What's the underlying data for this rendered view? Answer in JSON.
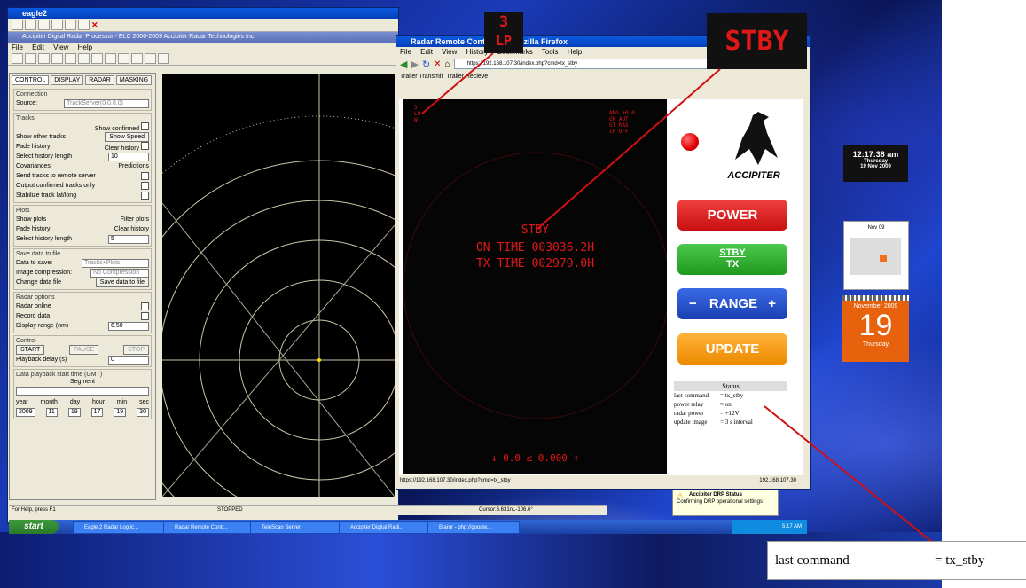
{
  "eagle": {
    "title": "eagle2",
    "subtitle": "Accipiter Digital Radar Processor - ELC 2006-2009 Accipiter Radar Technologies Inc.",
    "menu": [
      "File",
      "Edit",
      "View",
      "Help"
    ],
    "tabs": [
      "CONTROL",
      "DISPLAY",
      "RADAR",
      "MASKING"
    ],
    "connection": {
      "title": "Connection",
      "source_label": "Source:",
      "source_value": "TrackServer(0.0.0.0)"
    },
    "tracks": {
      "title": "Tracks",
      "show_confirmed": "Show confirmed",
      "show_other": "Show other tracks",
      "show_speed": "Show Speed",
      "fade_history": "Fade history",
      "clear_history": "Clear history",
      "select_length": "Select history length",
      "length_value": "10",
      "covariances": "Covariances",
      "predictions": "Predictions",
      "send_tracks": "Send tracks to remote server",
      "output_confirmed": "Output confirmed tracks only",
      "stabilize": "Stabilize track lat/long"
    },
    "plots": {
      "title": "Plots",
      "show_plots": "Show plots",
      "filter_plots": "Filter plots",
      "fade_history": "Fade history",
      "clear_history": "Clear history",
      "select_length": "Select history length",
      "length_value": "5"
    },
    "save": {
      "title": "Save data to file",
      "data_to_save": "Data to save:",
      "data_value": "Tracks+Plots",
      "compression": "Image compression:",
      "compression_value": "No Compression",
      "change_file": "Change data file",
      "save_button": "Save data to file"
    },
    "radar_options": {
      "title": "Radar options",
      "radar_online": "Radar online",
      "record_data": "Record data",
      "display_range": "Display range (nm)",
      "range_value": "6.50"
    },
    "control": {
      "title": "Control",
      "start": "START",
      "pause": "PAUSE",
      "stop": "STOP",
      "playback_delay": "Playback delay (s)",
      "delay_value": "0"
    },
    "playback": {
      "title": "Data playback start time (GMT)",
      "segment": "Segment",
      "cols": [
        "year",
        "month",
        "day",
        "hour",
        "min",
        "sec"
      ],
      "vals": [
        "2009",
        "11",
        "19",
        "17",
        "19",
        "30"
      ]
    },
    "status_left": "For Help, press F1",
    "status_mid": "STOPPED",
    "status_cursor": "Cursor:3.631nL-106.6°"
  },
  "firefox": {
    "title": "Radar Remote Controller - Mozilla Firefox",
    "menu": [
      "File",
      "Edit",
      "View",
      "History",
      "Bookmarks",
      "Tools",
      "Help"
    ],
    "url": "https://192.168.107.30/index.php?cmd=tx_stby",
    "bookmarks": [
      "Trailer Transmit",
      "Trailer Recieve"
    ],
    "status_url": "https://192.168.107.30/index.php?cmd=tx_stby",
    "status_ip": "192.168.107.30"
  },
  "crt": {
    "mode": "STBY",
    "on_time": "ON TIME 003036.2H",
    "tx_time": "TX TIME 002979.0H",
    "bottom": "↓  0.0 ≤ 0.000 ↑",
    "corner_tl": [
      "3",
      "LP",
      "W"
    ],
    "corner_tr": [
      "ANG +0.0",
      "GN AUT",
      "ST  RAS",
      "IR  OFF"
    ]
  },
  "controls": {
    "brand": "ACCIPITER",
    "power": "POWER",
    "stby": "STBY",
    "tx": "TX",
    "range": "RANGE",
    "range_minus": "−",
    "range_plus": "+",
    "update": "UPDATE",
    "power_indicator_color": "#e00000",
    "power_color": "#d81818",
    "stby_color": "#2aa82a",
    "range_color": "#1f4fd0",
    "update_color": "#f39a12"
  },
  "status": {
    "title": "Status",
    "rows": [
      {
        "k": "last command",
        "v": "= tx_stby"
      },
      {
        "k": "power relay",
        "v": "= on"
      },
      {
        "k": "radar power",
        "v": "= +12V"
      },
      {
        "k": "update image",
        "v": "= 3 s interval"
      }
    ]
  },
  "overlays": {
    "lp_top": "3",
    "lp_bottom": "LP",
    "stby": "STBY"
  },
  "notification": {
    "title": "Accipiter DRP Status",
    "body": "Confirming DRP operational settings"
  },
  "taskbar": {
    "start": "start",
    "items": [
      "Eagle 2 Radar Log.ic...",
      "Radar Remote Contr...",
      "TeleScan Server",
      "Accipiter Digital Radi...",
      "Blarnr - php://goodw..."
    ],
    "clock": "5:17 AM"
  },
  "gadgets": {
    "clock_time": "12:17:38 am",
    "clock_day": "Thursday",
    "clock_date": "19 Nov 2009",
    "cal_month": "Nov 09",
    "big_month": "November 2009",
    "big_day": "19",
    "big_weekday": "Thursday"
  },
  "callout": {
    "label": "last command",
    "value": "= tx_stby"
  }
}
